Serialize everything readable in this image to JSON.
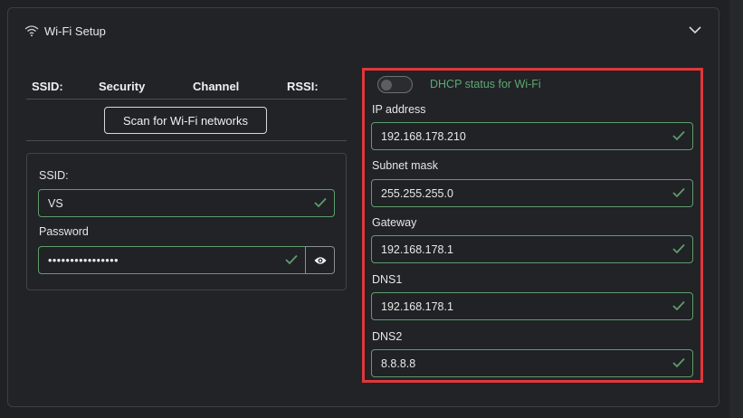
{
  "panel": {
    "title": "Wi-Fi Setup",
    "header_icon": "wifi-icon",
    "collapse_icon": "chevron-down-icon"
  },
  "networks_table": {
    "columns": [
      "SSID:",
      "Security",
      "Channel",
      "RSSI:"
    ],
    "scan_button": "Scan for Wi-Fi networks"
  },
  "credentials": {
    "ssid_label": "SSID:",
    "ssid_value": "VS",
    "password_label": "Password",
    "password_value": "••••••••••••••••",
    "show_password_icon": "eye-icon"
  },
  "ip_config": {
    "dhcp_label": "DHCP status for Wi-Fi",
    "dhcp_enabled": false,
    "fields": [
      {
        "label": "IP address",
        "value": "192.168.178.210"
      },
      {
        "label": "Subnet mask",
        "value": "255.255.255.0"
      },
      {
        "label": "Gateway",
        "value": "192.168.178.1"
      },
      {
        "label": "DNS1",
        "value": "192.168.178.1"
      },
      {
        "label": "DNS2",
        "value": "8.8.8.8"
      }
    ]
  },
  "colors": {
    "valid_green": "#5e9d6c",
    "highlight_red": "#e0373b"
  }
}
